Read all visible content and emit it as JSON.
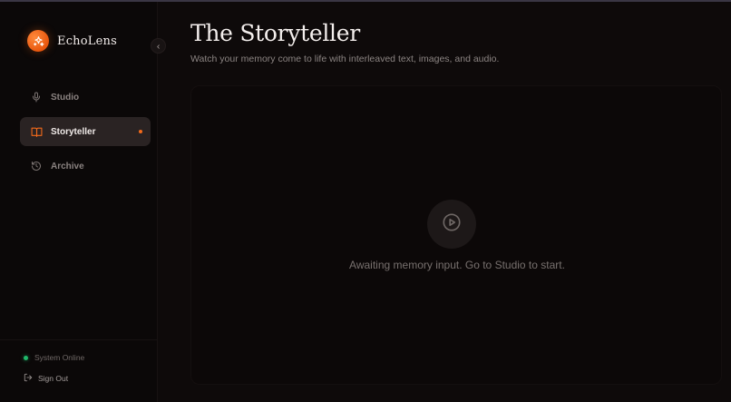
{
  "brand": {
    "name": "EchoLens"
  },
  "sidebar": {
    "items": [
      {
        "label": "Studio",
        "icon": "microphone-icon",
        "active": false
      },
      {
        "label": "Storyteller",
        "icon": "book-icon",
        "active": true
      },
      {
        "label": "Archive",
        "icon": "history-icon",
        "active": false
      }
    ],
    "status": "System Online",
    "sign_out": "Sign Out"
  },
  "main": {
    "title": "The Storyteller",
    "subtitle": "Watch your memory come to life with interleaved text, images, and audio.",
    "empty_state": "Awaiting memory input. Go to Studio to start."
  },
  "colors": {
    "accent": "#f26a1b",
    "background": "#0e0a0a",
    "status_online": "#1fb86a"
  }
}
